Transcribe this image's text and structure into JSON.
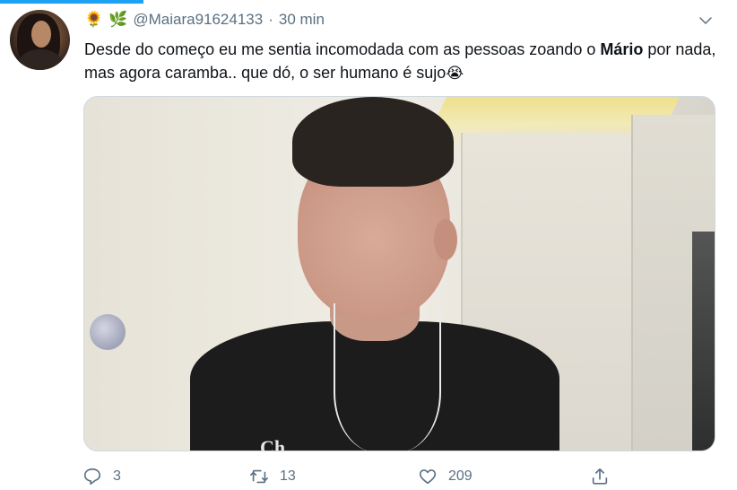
{
  "tweet": {
    "user": {
      "emoji_1": "🌻",
      "emoji_2": "🌿",
      "handle": "@Maiara91624133",
      "separator": "·",
      "time": "30 min"
    },
    "text_part_1": "Desde do começo eu me sentia incomodada com as pessoas zoando o ",
    "text_bold": "Mário",
    "text_part_2": " por nada, mas agora caramba.. que dó, o ser humano é sujo",
    "text_emoji": "😭",
    "media": {
      "shirt_text": "Ch"
    },
    "actions": {
      "replies": "3",
      "retweets": "13",
      "likes": "209"
    }
  },
  "colors": {
    "accent": "#1da1f2",
    "secondary_text": "#5b7083",
    "primary_text": "#0f1419"
  }
}
